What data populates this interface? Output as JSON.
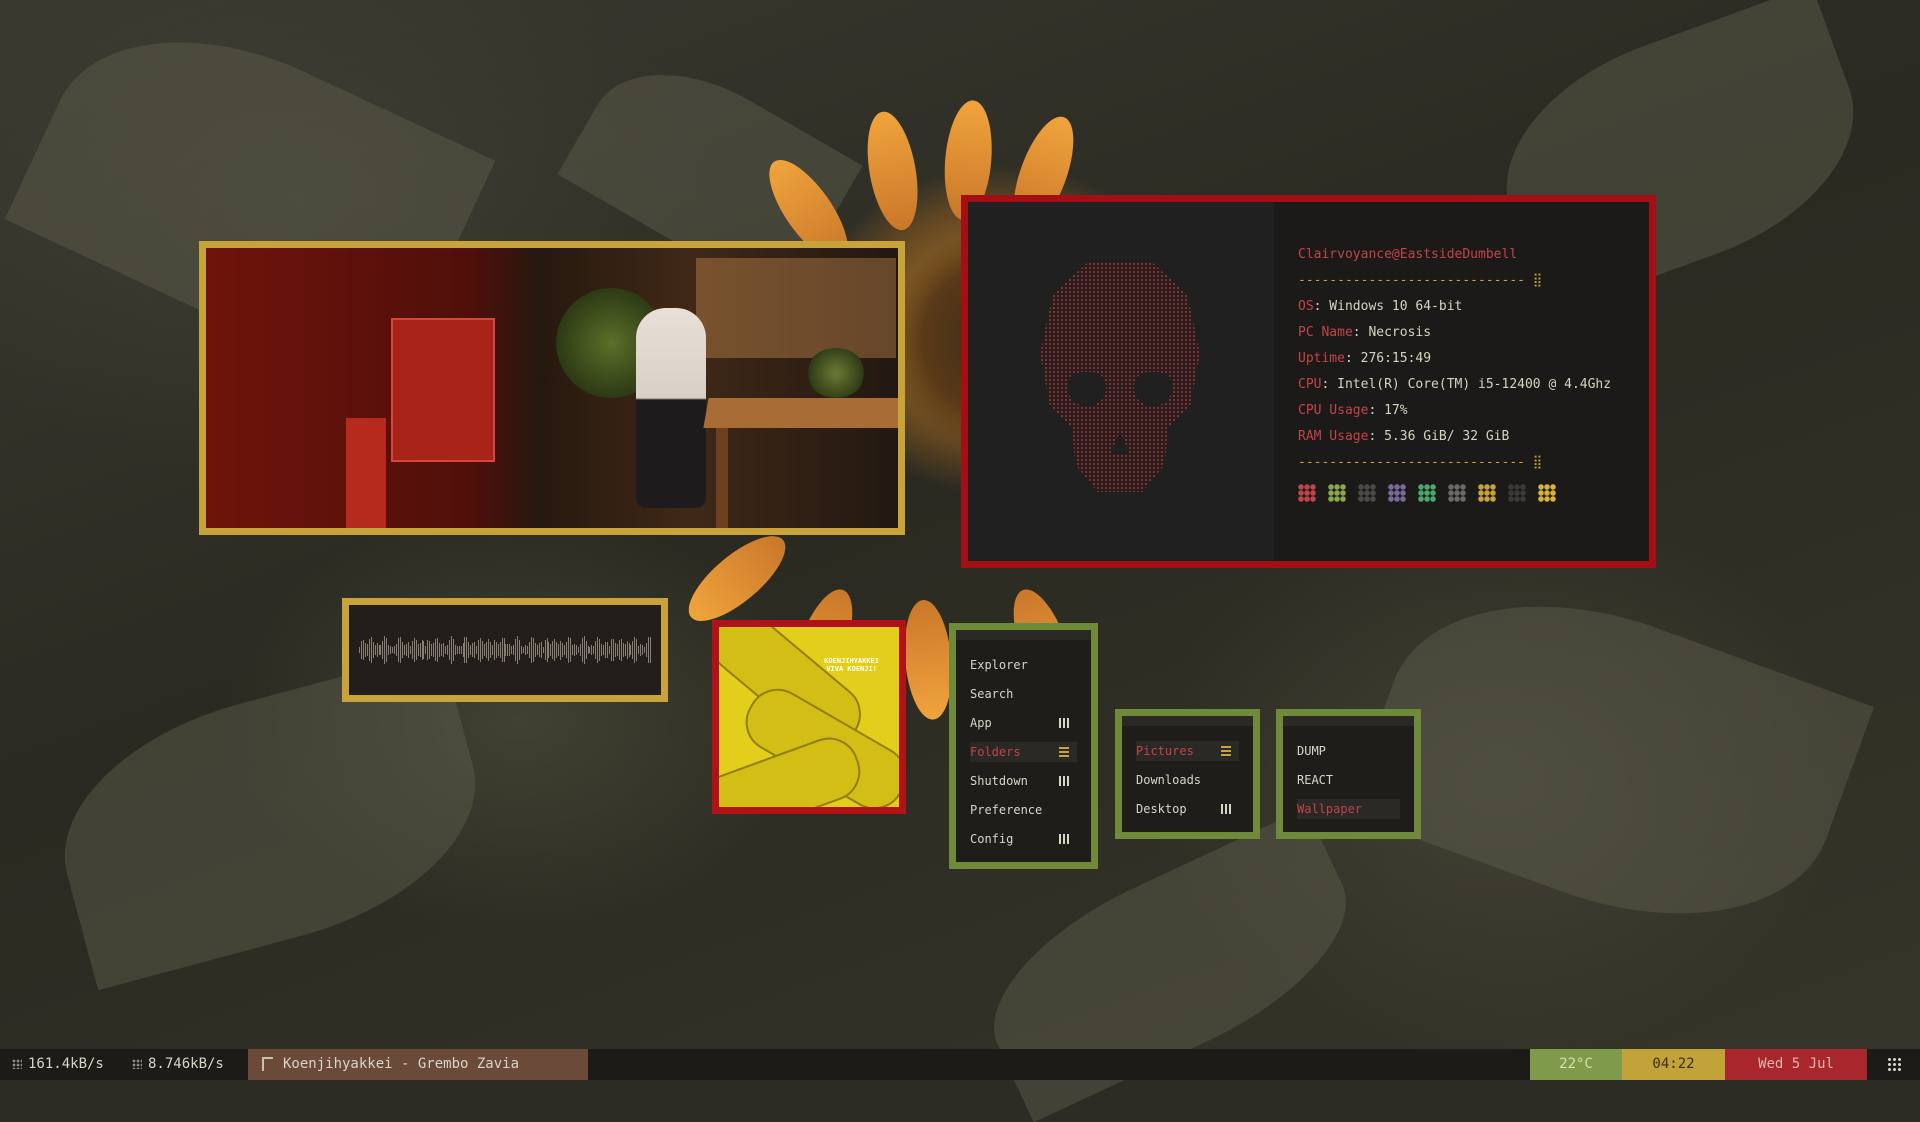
{
  "sysinfo": {
    "title": "Clairvoyance@EastsideDumbell",
    "separator": "----------------------------- ⣿",
    "rows": [
      {
        "key": "OS",
        "value": ": Windows 10 64-bit"
      },
      {
        "key": "PC Name",
        "value": ": Necrosis"
      },
      {
        "key": "Uptime",
        "value": ": 276:15:49"
      },
      {
        "key": "CPU",
        "value": ": Intel(R) Core(TM) i5-12400 @ 4.4Ghz"
      },
      {
        "key": "CPU Usage",
        "value": ": 17%"
      },
      {
        "key": "RAM Usage",
        "value": ": 5.36 GiB/ 32 GiB"
      }
    ],
    "color_blocks": [
      "#c0444a",
      "#8aa84a",
      "#4a4a48",
      "#7a6a9a",
      "#4aa86a",
      "#6a6a6a",
      "#c7a33a",
      "#3a3a38",
      "#d8b23a"
    ]
  },
  "menu_main": {
    "items": [
      "Explorer",
      "Search",
      "App",
      "Folders",
      "Shutdown",
      "Preference",
      "Config"
    ],
    "active": "Folders"
  },
  "menu_folders": {
    "items": [
      "Pictures",
      "Downloads",
      "Desktop"
    ],
    "active": "Pictures"
  },
  "menu_pictures": {
    "items": [
      "DUMP",
      "REACT",
      "Wallpaper"
    ],
    "active": "Wallpaper"
  },
  "album": {
    "artist_text": "KOENJIHYAKKEI",
    "album_text": "VIVA KOENJI!"
  },
  "taskbar": {
    "download": "161.4kB/s",
    "upload": "8.746kB/s",
    "now_playing": "Koenjihyakkei - Grembo Zavia",
    "temperature": "22°C",
    "time": "04:22",
    "date": "Wed 5 Jul"
  }
}
